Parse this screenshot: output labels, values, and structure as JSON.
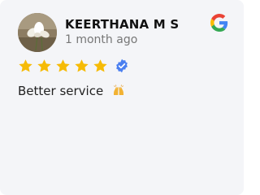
{
  "review": {
    "author": "KEERTHANA M S",
    "time": "1 month ago",
    "rating": 5,
    "verified": true,
    "text": "Better service",
    "emoji_icon": "raising-hands-icon",
    "source_icon": "google-icon",
    "avatar_icon": "flower-photo-avatar"
  },
  "colors": {
    "card_background": "#f4f5f8",
    "star": "#f6bb06",
    "verified_badge": "#4a7ff0",
    "google_blue": "#4285f4",
    "google_red": "#ea4335",
    "google_yellow": "#fbbc05",
    "google_green": "#34a853"
  }
}
